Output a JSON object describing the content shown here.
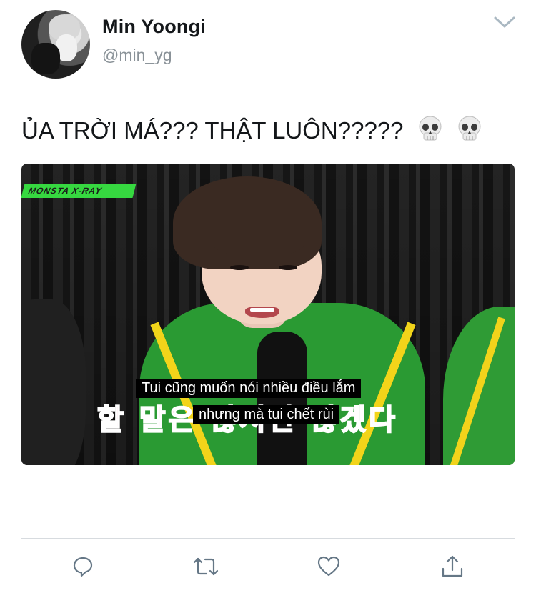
{
  "tweet": {
    "author": {
      "name": "Min Yoongi",
      "handle": "@min_yg"
    },
    "text": "ỦA TRỜI MÁ??? THẬT LUÔN?????",
    "emojis": [
      "💀",
      "💀"
    ],
    "media": {
      "logo_text": "MONSTA X-RAY",
      "korean_caption": "할 말은 많지만 않겠다",
      "subtitle_line_1": "Tui cũng muốn nói nhiều điều lắm",
      "subtitle_line_2": "nhưng mà tui chết rùi"
    }
  },
  "icons": {
    "menu": "chevron-down-icon",
    "reply": "reply-icon",
    "retweet": "retweet-icon",
    "like": "heart-icon",
    "share": "share-icon"
  },
  "colors": {
    "name": "#14171a",
    "handle": "#8a9298",
    "icon": "#657786",
    "divider": "#d7dbdf",
    "caption_pink": "#f03a78",
    "logo_green": "#36d840"
  }
}
